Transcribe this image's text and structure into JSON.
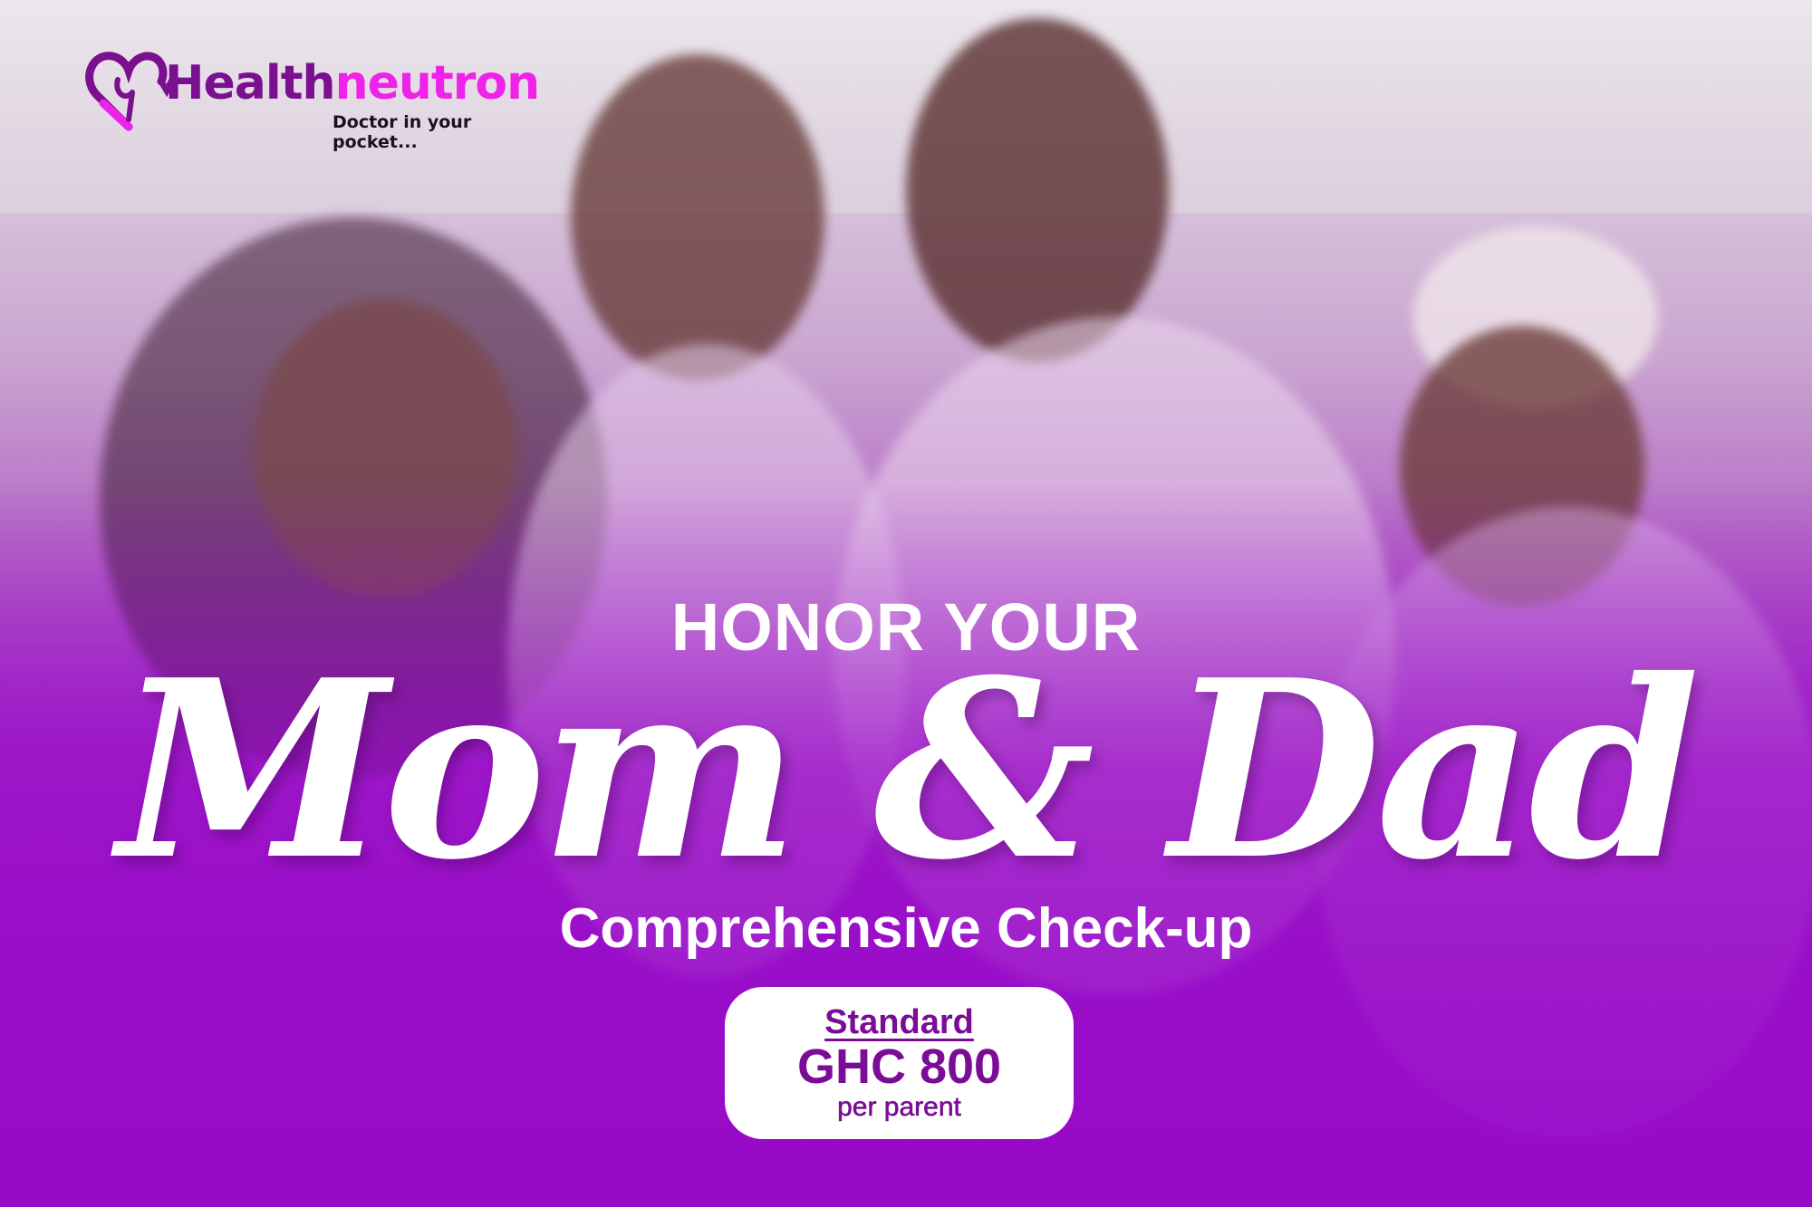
{
  "brand": {
    "name_part1": "Health",
    "name_part2": "neutron",
    "tagline": "Doctor in your pocket...",
    "colors": {
      "primary": "#7a0f8f",
      "accent": "#ee22e8"
    },
    "icon": "heart-stethoscope-icon"
  },
  "headline": {
    "kicker": "HONOR YOUR",
    "script": "Mom & Dad",
    "subtitle": "Comprehensive Check-up"
  },
  "offer": {
    "tier": "Standard",
    "price": "GHC 800",
    "unit": "per parent"
  },
  "colors": {
    "background": "#9a12c8",
    "text": "#ffffff",
    "price_text": "#7a0c96"
  }
}
